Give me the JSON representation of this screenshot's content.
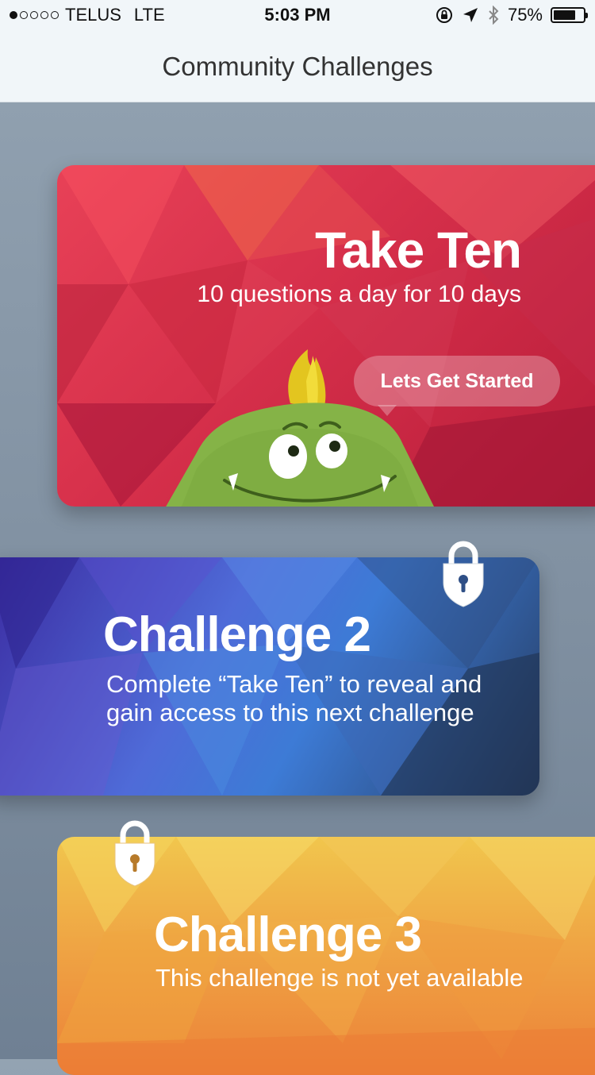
{
  "status_bar": {
    "signal_dots": [
      true,
      false,
      false,
      false,
      false
    ],
    "carrier": "TELUS",
    "network": "LTE",
    "time": "5:03 PM",
    "battery_percent_label": "75%",
    "battery_level": 0.75,
    "icons": [
      "orientation-lock-icon",
      "location-arrow-icon",
      "bluetooth-icon",
      "battery-icon"
    ]
  },
  "nav": {
    "title": "Community Challenges"
  },
  "cards": [
    {
      "title": "Take Ten",
      "subtitle": "10 questions a day for 10 days",
      "button_label": "Lets Get Started",
      "locked": false,
      "accent": "#d52f4a",
      "mascot": "green-monster"
    },
    {
      "title": "Challenge 2",
      "description": "Complete “Take Ten” to reveal and gain access to this next challenge",
      "locked": true,
      "accent": "#4f6bd8"
    },
    {
      "title": "Challenge 3",
      "description": "This challenge is not yet available",
      "locked": true,
      "accent": "#efa544"
    }
  ]
}
